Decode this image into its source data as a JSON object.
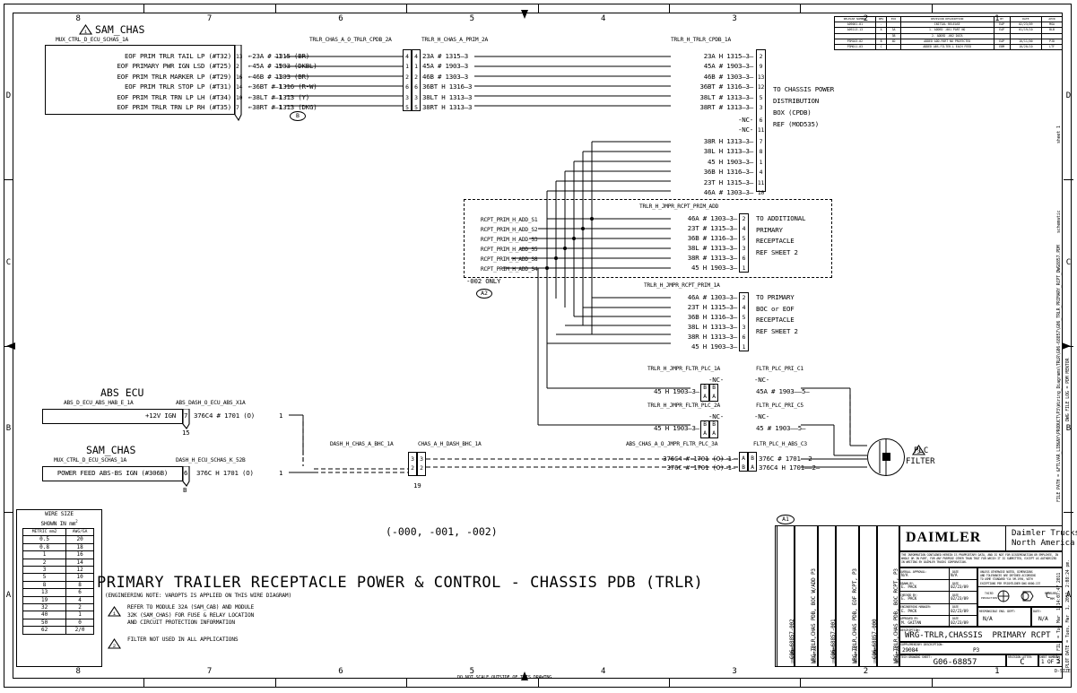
{
  "meta": {
    "zones_top": [
      "8",
      "7",
      "6",
      "5",
      "4",
      "3",
      "2",
      "1"
    ],
    "zones_side": [
      "D",
      "C",
      "B",
      "A"
    ],
    "size_label": "D-SIZE",
    "do_not_scale": "DO NOT SCALE OUTSIDE OF THIS DRAWING"
  },
  "sam_chas_top": {
    "title": "SAM_CHAS",
    "warning_num": "1",
    "conn_label": "MUX_CTRL_D_ECU_SCHAS_1A",
    "rows": [
      {
        "signal": "EOF PRIM TRLR TAIL LP (#T32)",
        "pin": "13",
        "wire": "23A # 1315 (BR)",
        "term": "1"
      },
      {
        "signal": "EOF PRIMARY PWR IGN LSD (#T25)",
        "pin": "2",
        "wire": "45A # 1903 (DKBL)",
        "term": "1"
      },
      {
        "signal": "EOF PRIM TRLR MARKER LP (#T29)",
        "pin": "16",
        "wire": "46B # 1303 (BR)",
        "term": "1"
      },
      {
        "signal": "EOF PRIM TRLR STOP LP (#T31)",
        "pin": "14",
        "wire": "36BT # 1316 (R-W)",
        "term": "1"
      },
      {
        "signal": "EOF PRIM TRLR TRN LP LH (#T34)",
        "pin": "10",
        "wire": "38LT # 1313 (Y)",
        "term": "1"
      },
      {
        "signal": "EOF PRIM TRLR TRN LP RH (#T35)",
        "pin": "7",
        "wire": "38RT # 1313 (DKG)",
        "term": "1"
      }
    ],
    "zone_tag": "B"
  },
  "mid_conn": {
    "label_left": "TRLR_CHAS_A_O_TRLR_CPDB_2A",
    "label_right": "TRLR_H_CHAS_A_PRIM_2A",
    "rows": [
      {
        "pin_l": "4",
        "pin_r": "4",
        "wire": "23A # 1315",
        "term": "3"
      },
      {
        "pin_l": "1",
        "pin_r": "1",
        "wire": "45A # 1903",
        "term": "3"
      },
      {
        "pin_l": "2",
        "pin_r": "2",
        "wire": "46B # 1303",
        "term": "3"
      },
      {
        "pin_l": "6",
        "pin_r": "6",
        "wire": "36BT H 1316",
        "term": "3"
      },
      {
        "pin_l": "3",
        "pin_r": "3",
        "wire": "38LT H 1313",
        "term": "3"
      },
      {
        "pin_l": "5",
        "pin_r": "5",
        "wire": "38RT H 1313",
        "term": "3"
      }
    ]
  },
  "cpdb": {
    "label": "TRLR_H_TRLR_CPDB_1A",
    "rows_top": [
      {
        "wire": "23A H 1315",
        "term": "3",
        "pin": "2"
      },
      {
        "wire": "45A # 1903",
        "term": "3",
        "pin": "9"
      },
      {
        "wire": "46B # 1303",
        "term": "3",
        "pin": "13"
      },
      {
        "wire": "36BT # 1316",
        "term": "3",
        "pin": "12"
      },
      {
        "wire": "38LT # 1313",
        "term": "3",
        "pin": "5"
      },
      {
        "wire": "38RT # 1313",
        "term": "3",
        "pin": "3"
      }
    ],
    "nc_rows": [
      {
        "wire": "-NC-",
        "pin": "6"
      },
      {
        "wire": "-NC-",
        "pin": "11"
      }
    ],
    "rows_bottom": [
      {
        "wire": "38R H 1313",
        "term": "3",
        "pin": "7"
      },
      {
        "wire": "38L H 1313",
        "term": "3",
        "pin": "8"
      },
      {
        "wire": "45 H 1903",
        "term": "3",
        "pin": "1"
      },
      {
        "wire": "36B H 1316",
        "term": "3",
        "pin": "4"
      },
      {
        "wire": "23T H 1315",
        "term": "3",
        "pin": "11"
      },
      {
        "wire": "46A # 1303",
        "term": "3",
        "pin": "10"
      }
    ],
    "note": [
      "TO CHASSIS POWER",
      "DISTRIBUTION",
      "BOX (CPDB)",
      "REF (MOD535)"
    ]
  },
  "rcpt_add": {
    "label": "TRLR_H_JMPR_RCPT_PRIM_ADD",
    "left_labels": [
      "RCPT_PRIM_H_ADD_S1",
      "RCPT_PRIM_H_ADD_S2",
      "RCPT_PRIM_H_ADD_S3",
      "RCPT_PRIM_H_ADD_S5",
      "RCPT_PRIM_H_ADD_S8",
      "RCPT_PRIM_H_ADD_S4"
    ],
    "rows": [
      {
        "wire": "46A # 1303",
        "term": "3",
        "pin": "2"
      },
      {
        "wire": "23T # 1315",
        "term": "3",
        "pin": "4"
      },
      {
        "wire": "36B # 1316",
        "term": "3",
        "pin": "5"
      },
      {
        "wire": "38L # 1313",
        "term": "3",
        "pin": "3"
      },
      {
        "wire": "38R # 1313",
        "term": "3",
        "pin": "6"
      },
      {
        "wire": "45 H 1903",
        "term": "3",
        "pin": "1"
      }
    ],
    "note": [
      "TO ADDITIONAL",
      "PRIMARY",
      "RECEPTACLE",
      "REF SHEET 2"
    ],
    "variant": "-002 ONLY",
    "zone_tag": "A2"
  },
  "rcpt_prim": {
    "label": "TRLR_H_JMPR_RCPT_PRIM_1A",
    "rows": [
      {
        "wire": "46A # 1303",
        "term": "3",
        "pin": "2"
      },
      {
        "wire": "23T H 1315",
        "term": "3",
        "pin": "4"
      },
      {
        "wire": "36B H 1316",
        "term": "3",
        "pin": "5"
      },
      {
        "wire": "38L H 1313",
        "term": "3",
        "pin": "3"
      },
      {
        "wire": "38R H 1313",
        "term": "3",
        "pin": "6"
      },
      {
        "wire": "45 H 1903",
        "term": "3",
        "pin": "1"
      }
    ],
    "note": [
      "TO PRIMARY",
      "BOC or EOF",
      "RECEPTACLE",
      "REF SHEET 2"
    ]
  },
  "plc_rows": [
    {
      "label_left": "TRLR_H_JMPR_FLTR_PLC_1A",
      "label_right": "FLTR_PLC_PRI_C1",
      "wire_in": "45 H 1903",
      "term_in": "3",
      "nc_left": "-NC-",
      "nc_right": "-NC-",
      "pins_left": [
        "B",
        "A"
      ],
      "pins_right": [
        "B",
        "A"
      ],
      "wire_out": "45A # 1903",
      "term_out": "5"
    },
    {
      "label_left": "TRLR_H_JMPR_FLTR_PLC_2A",
      "label_right": "FLTR_PLC_PRI_C5",
      "wire_in": "45 H 1903",
      "term_in": "3",
      "nc_left": "-NC-",
      "nc_right": "-NC-",
      "pins_left": [
        "B",
        "A"
      ],
      "pins_right": [
        "B",
        "A"
      ],
      "wire_out": "45 # 1903",
      "term_out": "5"
    }
  ],
  "abs_plc": {
    "label_left": "ABS_CHAS_A_O_JMPR_FLTR_PLC_3A",
    "label_right": "FLTR_PLC_H_ABS_C3",
    "rows": [
      {
        "wire_in": "376C4 # 1701 (O)",
        "term_in": "1",
        "pin_l": "A",
        "pin_r": "B",
        "wire_out": "376C # 1701",
        "term_out": "2"
      },
      {
        "wire_in": "376C # 1701 (O)",
        "term_in": "1",
        "pin_l": "B",
        "pin_r": "A",
        "wire_out": "376C4 H 1701",
        "term_out": "2"
      }
    ]
  },
  "plc_filter": {
    "name_line1": "PLC",
    "name_line2": "FILTER",
    "warning_num": "2"
  },
  "abs_ecu": {
    "title": "ABS ECU",
    "conn_label": "ABS_D_ECU_ABS_HAB_E_1A",
    "conn_label_right": "ABS_DASH_O_ECU_ABS_X1A",
    "signal": "+12V IGN",
    "pin": "7",
    "pin_sub": "15",
    "wire": "376C4 # 1701 (O)",
    "term": "1"
  },
  "sam_chas_bot": {
    "title": "SAM_CHAS",
    "conn_label": "MUX_CTRL_D_ECU_SCHAS_1A",
    "conn_label_right": "DASH_H_ECU_SCHAS_K_52B",
    "signal": "POWER FEED ABS-BS IGN (#306B)",
    "pin": "6",
    "pin_sub": "B",
    "wire": "376C H 1701 (O)",
    "term": "1"
  },
  "dash_conn": {
    "label_left": "DASH_H_CHAS_A_BHC_1A",
    "label_right": "CHAS_A_H_DASH_BHC_1A",
    "pins_left": [
      "3",
      "2"
    ],
    "pins_right": [
      "3",
      "2"
    ],
    "sub": "19"
  },
  "wire_size_table": {
    "title_line1": "WIRE SIZE",
    "title_line2": "SHOWN IN mm",
    "title_sup": "2",
    "headers": [
      "METRIC mm2",
      "AWG/GA"
    ],
    "rows": [
      [
        "0.5",
        "20"
      ],
      [
        "0.8",
        "18"
      ],
      [
        "1",
        "16"
      ],
      [
        "2",
        "14"
      ],
      [
        "3",
        "12"
      ],
      [
        "5",
        "10"
      ],
      [
        "8",
        "8"
      ],
      [
        "13",
        "6"
      ],
      [
        "19",
        "4"
      ],
      [
        "32",
        "2"
      ],
      [
        "40",
        "1"
      ],
      [
        "50",
        "0"
      ],
      [
        "62",
        "2/0"
      ]
    ]
  },
  "sheet_title": {
    "variants": "(-000, -001, -002)",
    "main": "PRIMARY TRAILER RECEPTACLE POWER & CONTROL - CHASSIS PDB (TRLR)",
    "eng_note": "(ENGINEERING NOTE: VAROPTS IS APPLIED ON THIS WIRE DIAGRAM)",
    "notes": [
      {
        "num": "1",
        "lines": [
          "REFER TO MODULE 32A (SAM_CAB) AND MODULE",
          "32K (SAM_CHAS) FOR FUSE & RELAY LOCATION",
          "AND CIRCUIT PROTECTION INFORMATION"
        ]
      },
      {
        "num": "2",
        "lines": [
          "FILTER NOT USED IN ALL APPLICATIONS"
        ]
      }
    ],
    "zone_tag": "A1"
  },
  "title_block": {
    "brand": "DAIMLER",
    "company_line1": "Daimler Trucks",
    "company_line2": "North America",
    "items": [
      {
        "item_hdr": "ITEM NUMBER:",
        "item": "G06-68857-002",
        "desc_hdr": "DESCRIPTION:",
        "desc": "WRG-TRLR,CHAS PDB, BOC W/ADD P3"
      },
      {
        "item_hdr": "ITEM NUMBER:",
        "item": "G06-68857-001",
        "desc_hdr": "DESCRIPTION:",
        "desc": "WRG-TRLR,CHAS PDB, EOF RCPT, P3"
      },
      {
        "item_hdr": "ITEM NUMBER:",
        "item": "G06-68857-000",
        "desc_hdr": "DESCRIPTION:",
        "desc": "WRG-TRLR,CHAS PDB, BOC RCPT, P3"
      }
    ],
    "proprietary": "THE INFORMATION CONTAINED HEREIN IS PROPRIETARY DATA, AND IS NOT FOR DISSEMINATION OR EMPLOYEE, IN WHOLE OR IN PART, FOR ANY PURPOSE OTHER THAN THAT FOR WHICH IT IS SUBMITTED, EXCEPT AS AUTHORIZED IN WRITING BY DAIMLER TRUCKS CORPORATION.",
    "approvals": [
      {
        "label": "OVERALL APPROVAL:",
        "name": "N/A",
        "date_hdr": "DATE",
        "date": "N/A"
      },
      {
        "label": "DRAWN BY:",
        "name": "E. PACK",
        "date_hdr": "DATE",
        "date": "02/23/09"
      },
      {
        "label": "CHECKED BY:",
        "name": "E. PACK",
        "date_hdr": "DATE",
        "date": "02/23/09"
      },
      {
        "label": "ENGINEERING MANAGER:",
        "name": "E. PACK",
        "date_hdr": "DATE",
        "date": "02/23/09"
      },
      {
        "label": "APPROVED BY:",
        "name": "M. GAITAN",
        "date_hdr": "DATE",
        "date": "02/23/09"
      }
    ],
    "tolerance_note": [
      "UNLESS OTHERWISE NOTED, DIMENSIONS",
      "AND TOLERANCES ARE DEFINED ACCORDING",
      "TO ASME STANDARD Y14 5M-1994, WITH",
      "EXCEPTIONS PER FRIGHTLINER DWG 6600-137"
    ],
    "symbols": [
      "THIRD ANGLE PROJECTION",
      "MEASURE IN MM"
    ],
    "resp_eng_hdr": "RESPONSIBLE ENG. DEPT:",
    "resp_eng": "N/A",
    "date_hdr2": "DATE:",
    "date2": "N/A",
    "description_hdr": "DESCRIPTION:",
    "description": "WRG-TRLR,CHASSIS  PRIMARY RCPT",
    "suppl_hdr": "SUPPLEMENTARY DESCRIPTION:",
    "suppl": "29084",
    "suppl2": "P3",
    "dwg_hdr": "TECH DRAWING SHEET:",
    "dwg": "G06-68857",
    "rev_hdr": "REVISION LETTER:",
    "rev": "C",
    "sheet_hdr": "SHEET NUMBER:",
    "sheet": "1 OF 2"
  },
  "revision_table": {
    "headers": [
      "RELEASE NUMBER",
      "REV",
      "ECO",
      "REVISION DESCRIPTION",
      "BY",
      "DATE",
      "APVD"
    ],
    "rows": [
      [
        "A09001-01",
        "-",
        "",
        "INITIAL RELEASE",
        "EAP",
        "02/23/09",
        "MGA"
      ],
      [
        "A09213-13",
        "A",
        "3A",
        "1. ADDED -001 PART NO",
        "EAP",
        "01/19/10",
        "BLB"
      ],
      [
        "",
        "",
        "3B",
        "2. ADDED -002 DATA",
        "",
        "",
        ""
      ],
      [
        "P3M103-02",
        "B",
        "4D",
        "ADDED ADD-PART NO PROTECTED",
        "EAP",
        "10/11/00",
        "PJD"
      ],
      [
        "P3M011-03",
        "C",
        "",
        "ADDED ABS-FILTER-L EACH FEED",
        "EBM",
        "10/20/10",
        "LTF"
      ]
    ]
  },
  "side_text": {
    "file_path": "FILE PATH = &FTLVAR_LIB&NY\\PRODUCT\\P3\\Wiring_Diagrams\\TRLR\\G06-68857\\G06_TRLR_PRIMARY_RCPT_DWG8857.PDM",
    "dwg_file_log": "DWG FILE LOG = PDM MENTOR",
    "last_file": "LAST FILE = Tue Mar  1 14:07:47 2011",
    "plot_date": "PLOT DATE = Tues, Mar  1, 2011, 2:08:24 pm.",
    "sheet_label": "sheet 1",
    "schematic_label": "schematic"
  }
}
